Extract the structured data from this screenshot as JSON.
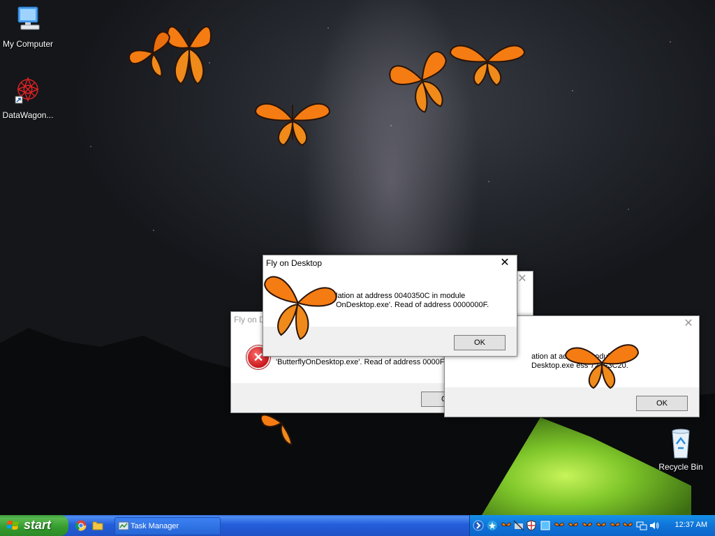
{
  "desktop": {
    "icons": [
      {
        "label": "My Computer"
      },
      {
        "label": "DataWagon..."
      },
      {
        "label": "Recycle Bin"
      }
    ]
  },
  "dialogs": [
    {
      "title": "Fly on Desktop",
      "message_line1": "",
      "message_line2": "'ButterflyOnDesktop.exe'. Read of address 0000FFFF.",
      "ok": "OK"
    },
    {
      "title": "",
      "message_line1": "",
      "message_line2": "",
      "ok": "OK"
    },
    {
      "title": "",
      "message_line1": "lation at address 0040350C in module",
      "message_line2": "OnDesktop.exe'. Read of address 0000000F.",
      "ok": "OK"
    },
    {
      "title": "",
      "message_line1": "ation at ad          4035          module",
      "message_line2": "Desktop.exe          ess 722F3C20.",
      "ok": "OK"
    }
  ],
  "front_dialog": {
    "title": "Fly on Desktop",
    "close": "✕"
  },
  "taskbar": {
    "start_label": "start",
    "task_button": "Task Manager",
    "clock": "12:37 AM"
  },
  "colors": {
    "taskbar": "#245edb",
    "start": "#349b2e",
    "tray": "#0f74d9",
    "error": "#c9161b",
    "butterfly": "#f57c12"
  }
}
